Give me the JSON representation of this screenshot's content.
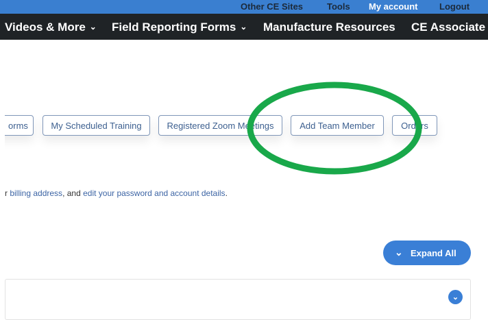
{
  "top_links": [
    "Other CE Sites",
    "Tools",
    "My account",
    "Logout"
  ],
  "nav": {
    "items": [
      "Videos & More",
      "Field Reporting Forms",
      "Manufacture Resources",
      "CE Associate"
    ]
  },
  "tabs": {
    "forms": "orms",
    "scheduled_training": "My Scheduled Training",
    "zoom_meetings": "Registered Zoom Meetings",
    "add_team_member": "Add Team Member",
    "orders": "Orders"
  },
  "info": {
    "prefix": "r ",
    "billing_link": "billing address",
    "middle": ", and ",
    "password_link": "edit your password and account details",
    "suffix": "."
  },
  "expand_all": "Expand All",
  "colors": {
    "topbar": "#3a7fd0",
    "nav_bg": "#1f2326",
    "accent": "#3a7fd6",
    "annotation": "#19a84a"
  },
  "icons": {
    "nav_caret": "chevron-down-icon",
    "expand": "chevron-down-icon",
    "panel_toggle": "chevron-down-icon"
  }
}
